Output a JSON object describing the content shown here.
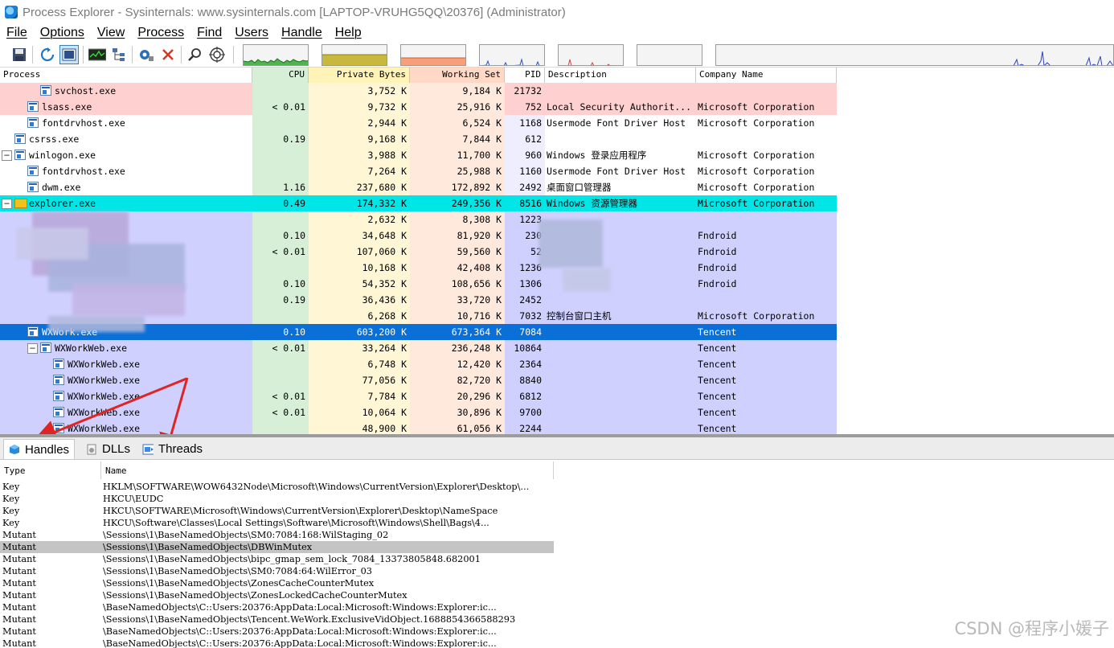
{
  "window": {
    "title": "Process Explorer - Sysinternals: www.sysinternals.com [LAPTOP-VRUHG5QQ\\20376] (Administrator)"
  },
  "menu": [
    "File",
    "Options",
    "View",
    "Process",
    "Find",
    "Users",
    "Handle",
    "Help"
  ],
  "toolbar": {
    "buttons": [
      "save-icon",
      "refresh-icon",
      "show-lower-pane-icon",
      "system-info-icon",
      "process-tree-icon",
      "properties-icon",
      "kill-process-icon",
      "find-icon",
      "target-icon"
    ]
  },
  "columns": {
    "process": "Process",
    "cpu": "CPU",
    "private": "Private Bytes",
    "working": "Working Set",
    "pid": "PID",
    "description": "Description",
    "company": "Company Name"
  },
  "colors": {
    "service": "#ffd0d0",
    "own": "#d0d0ff",
    "selected": "#0a6fd6",
    "explorer": "#00e6e6",
    "cpu_col": "#d6efd6",
    "private_col": "#fff6d5",
    "working_col": "#ffe8dc",
    "pid_col": "#eeeeff"
  },
  "processes": [
    {
      "name": "svchost.exe",
      "cpu": "",
      "private": "3,752 K",
      "working": "9,184 K",
      "pid": "21732",
      "desc": "",
      "company": "",
      "bg": "service",
      "indent": 3
    },
    {
      "name": "lsass.exe",
      "cpu": "< 0.01",
      "private": "9,732 K",
      "working": "25,916 K",
      "pid": "752",
      "desc": "Local Security Authorit...",
      "company": "Microsoft Corporation",
      "bg": "service",
      "indent": 2
    },
    {
      "name": "fontdrvhost.exe",
      "cpu": "",
      "private": "2,944 K",
      "working": "6,524 K",
      "pid": "1168",
      "desc": "Usermode Font Driver Host",
      "company": "Microsoft Corporation",
      "bg": "",
      "indent": 2
    },
    {
      "name": "csrss.exe",
      "cpu": "0.19",
      "private": "9,168 K",
      "working": "7,844 K",
      "pid": "612",
      "desc": "",
      "company": "",
      "bg": "",
      "indent": 1
    },
    {
      "name": "winlogon.exe",
      "cpu": "",
      "private": "3,988 K",
      "working": "11,700 K",
      "pid": "960",
      "desc": "Windows 登录应用程序",
      "company": "Microsoft Corporation",
      "bg": "",
      "indent": 1,
      "expander": true
    },
    {
      "name": "fontdrvhost.exe",
      "cpu": "",
      "private": "7,264 K",
      "working": "25,988 K",
      "pid": "1160",
      "desc": "Usermode Font Driver Host",
      "company": "Microsoft Corporation",
      "bg": "",
      "indent": 2
    },
    {
      "name": "dwm.exe",
      "cpu": "1.16",
      "private": "237,680 K",
      "working": "172,892 K",
      "pid": "2492",
      "desc": "桌面窗口管理器",
      "company": "Microsoft Corporation",
      "bg": "",
      "indent": 2
    },
    {
      "name": "explorer.exe",
      "cpu": "0.49",
      "private": "174,332 K",
      "working": "249,356 K",
      "pid": "8516",
      "desc": "Windows 资源管理器",
      "company": "Microsoft Corporation",
      "bg": "explorer",
      "indent": 1,
      "expander": true,
      "folder": true
    },
    {
      "name": "",
      "cpu": "",
      "private": "2,632 K",
      "working": "8,308 K",
      "pid": "1223",
      "desc": "",
      "company": "",
      "bg": "own",
      "indent": 2
    },
    {
      "name": "",
      "cpu": "0.10",
      "private": "34,648 K",
      "working": "81,920 K",
      "pid": "230",
      "desc": "",
      "company": "Fndroid",
      "bg": "own",
      "indent": 2
    },
    {
      "name": "",
      "cpu": "< 0.01",
      "private": "107,060 K",
      "working": "59,560 K",
      "pid": "52",
      "desc": "",
      "company": "Fndroid",
      "bg": "own",
      "indent": 3
    },
    {
      "name": "",
      "cpu": "",
      "private": "10,168 K",
      "working": "42,408 K",
      "pid": "1236",
      "desc": "",
      "company": "Fndroid",
      "bg": "own",
      "indent": 3
    },
    {
      "name": "",
      "cpu": "0.10",
      "private": "54,352 K",
      "working": "108,656 K",
      "pid": "1306",
      "desc": "",
      "company": "Fndroid",
      "bg": "own",
      "indent": 3
    },
    {
      "name": "",
      "cpu": "0.19",
      "private": "36,436 K",
      "working": "33,720 K",
      "pid": "2452",
      "desc": "",
      "company": "",
      "bg": "own",
      "indent": 4
    },
    {
      "name": "",
      "cpu": "",
      "private": "6,268 K",
      "working": "10,716 K",
      "pid": "7032",
      "desc": "控制台窗口主机",
      "company": "Microsoft Corporation",
      "bg": "own",
      "indent": 5
    },
    {
      "name": "WXWork.exe",
      "cpu": "0.10",
      "private": "603,200 K",
      "working": "673,364 K",
      "pid": "7084",
      "desc": "",
      "company": "Tencent",
      "bg": "selected",
      "indent": 2
    },
    {
      "name": "WXWorkWeb.exe",
      "cpu": "< 0.01",
      "private": "33,264 K",
      "working": "236,248 K",
      "pid": "10864",
      "desc": "",
      "company": "Tencent",
      "bg": "own",
      "indent": 3,
      "expander": true
    },
    {
      "name": "WXWorkWeb.exe",
      "cpu": "",
      "private": "6,748 K",
      "working": "12,420 K",
      "pid": "2364",
      "desc": "",
      "company": "Tencent",
      "bg": "own",
      "indent": 4
    },
    {
      "name": "WXWorkWeb.exe",
      "cpu": "",
      "private": "77,056 K",
      "working": "82,720 K",
      "pid": "8840",
      "desc": "",
      "company": "Tencent",
      "bg": "own",
      "indent": 4
    },
    {
      "name": "WXWorkWeb.exe",
      "cpu": "< 0.01",
      "private": "7,784 K",
      "working": "20,296 K",
      "pid": "6812",
      "desc": "",
      "company": "Tencent",
      "bg": "own",
      "indent": 4
    },
    {
      "name": "WXWorkWeb.exe",
      "cpu": "< 0.01",
      "private": "10,064 K",
      "working": "30,896 K",
      "pid": "9700",
      "desc": "",
      "company": "Tencent",
      "bg": "own",
      "indent": 4
    },
    {
      "name": "WXWorkWeb.exe",
      "cpu": "",
      "private": "48,900 K",
      "working": "61,056 K",
      "pid": "2244",
      "desc": "",
      "company": "Tencent",
      "bg": "own",
      "indent": 4
    }
  ],
  "tabs": [
    "Handles",
    "DLLs",
    "Threads"
  ],
  "handle_columns": {
    "type": "Type",
    "name": "Name"
  },
  "handles": [
    {
      "type": "Key",
      "name": "HKLM\\SOFTWARE\\WOW6432Node\\Microsoft\\Windows\\CurrentVersion\\Explorer\\Desktop\\..."
    },
    {
      "type": "Key",
      "name": "HKCU\\EUDC"
    },
    {
      "type": "Key",
      "name": "HKCU\\SOFTWARE\\Microsoft\\Windows\\CurrentVersion\\Explorer\\Desktop\\NameSpace"
    },
    {
      "type": "Key",
      "name": "HKCU\\Software\\Classes\\Local Settings\\Software\\Microsoft\\Windows\\Shell\\Bags\\4..."
    },
    {
      "type": "Mutant",
      "name": "\\Sessions\\1\\BaseNamedObjects\\SM0:7084:168:WilStaging_02"
    },
    {
      "type": "Mutant",
      "name": "\\Sessions\\1\\BaseNamedObjects\\DBWinMutex",
      "selected": true
    },
    {
      "type": "Mutant",
      "name": "\\Sessions\\1\\BaseNamedObjects\\bipc_gmap_sem_lock_7084_13373805848.682001"
    },
    {
      "type": "Mutant",
      "name": "\\Sessions\\1\\BaseNamedObjects\\SM0:7084:64:WilError_03"
    },
    {
      "type": "Mutant",
      "name": "\\Sessions\\1\\BaseNamedObjects\\ZonesCacheCounterMutex"
    },
    {
      "type": "Mutant",
      "name": "\\Sessions\\1\\BaseNamedObjects\\ZonesLockedCacheCounterMutex"
    },
    {
      "type": "Mutant",
      "name": "\\BaseNamedObjects\\C::Users:20376:AppData:Local:Microsoft:Windows:Explorer:ic..."
    },
    {
      "type": "Mutant",
      "name": "\\Sessions\\1\\BaseNamedObjects\\Tencent.WeWork.ExclusiveVidObject.1688854366588293"
    },
    {
      "type": "Mutant",
      "name": "\\BaseNamedObjects\\C::Users:20376:AppData:Local:Microsoft:Windows:Explorer:ic..."
    },
    {
      "type": "Mutant",
      "name": "\\BaseNamedObjects\\C::Users:20376:AppData:Local:Microsoft:Windows:Explorer:ic..."
    }
  ],
  "watermark": "CSDN @程序小媛子"
}
